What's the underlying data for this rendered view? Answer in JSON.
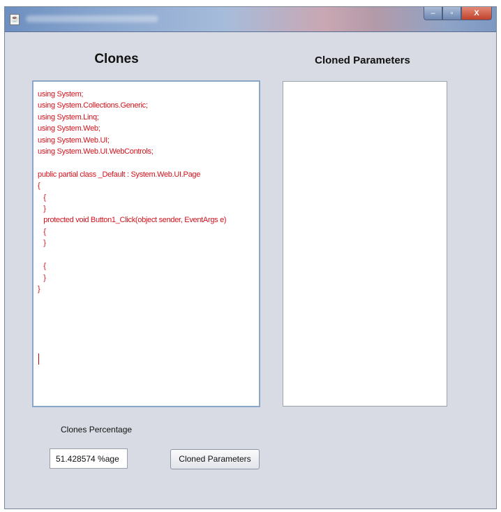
{
  "window": {
    "title": "",
    "buttons": {
      "minimize": "‒",
      "maximize": "▫",
      "close": "X"
    }
  },
  "labels": {
    "clones_heading": "Clones",
    "cloned_parameters_heading": "Cloned Parameters",
    "clones_percentage": "Clones Percentage"
  },
  "code_lines": [
    "using System;",
    "using System.Collections.Generic;",
    "using System.Linq;",
    "using System.Web;",
    "using System.Web.UI;",
    "using System.Web.UI.WebControls;",
    "",
    "public partial class _Default : System.Web.UI.Page",
    "{",
    "   {",
    "   }",
    "   protected void Button1_Click(object sender, EventArgs e)",
    "   {",
    "   }",
    "",
    "   {",
    "   }",
    "}"
  ],
  "clones_percentage_value": "51.428574 %age",
  "cloned_parameters_button": "Cloned Parameters",
  "colors": {
    "code_text": "#d4101a",
    "window_bg": "#d8dbe3"
  }
}
